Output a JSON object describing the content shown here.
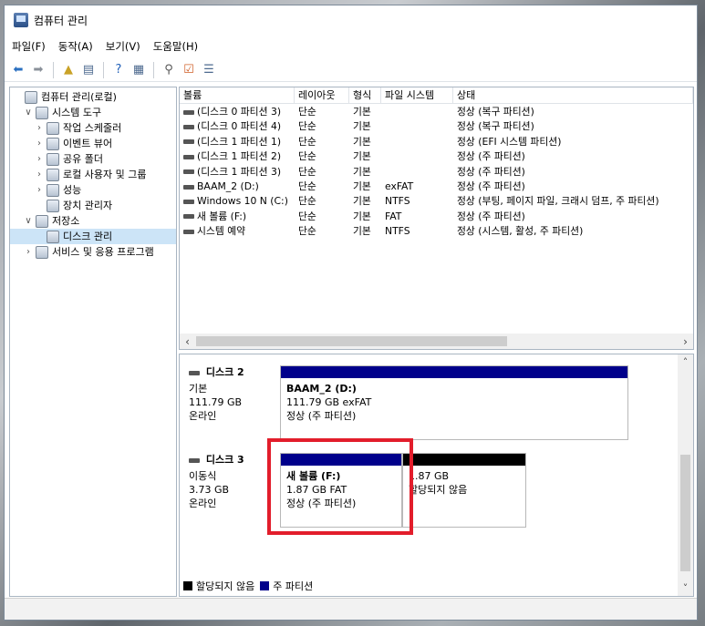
{
  "window": {
    "title": "컴퓨터 관리"
  },
  "menu": [
    "파일(F)",
    "동작(A)",
    "보기(V)",
    "도움말(H)"
  ],
  "tree": [
    {
      "label": "컴퓨터 관리(로컬)",
      "level": 0,
      "expander": ""
    },
    {
      "label": "시스템 도구",
      "level": 1,
      "expander": "∨"
    },
    {
      "label": "작업 스케줄러",
      "level": 2,
      "expander": "›"
    },
    {
      "label": "이벤트 뷰어",
      "level": 2,
      "expander": "›"
    },
    {
      "label": "공유 폴더",
      "level": 2,
      "expander": "›"
    },
    {
      "label": "로컬 사용자 및 그룹",
      "level": 2,
      "expander": "›"
    },
    {
      "label": "성능",
      "level": 2,
      "expander": "›"
    },
    {
      "label": "장치 관리자",
      "level": 2,
      "expander": ""
    },
    {
      "label": "저장소",
      "level": 1,
      "expander": "∨"
    },
    {
      "label": "디스크 관리",
      "level": 2,
      "expander": "",
      "selected": true
    },
    {
      "label": "서비스 및 응용 프로그램",
      "level": 1,
      "expander": "›"
    }
  ],
  "volume_list": {
    "headers": [
      "볼륨",
      "레이아웃",
      "형식",
      "파일 시스템",
      "상태"
    ],
    "rows": [
      [
        "(디스크 0 파티션 3)",
        "단순",
        "기본",
        "",
        "정상 (복구 파티션)"
      ],
      [
        "(디스크 0 파티션 4)",
        "단순",
        "기본",
        "",
        "정상 (복구 파티션)"
      ],
      [
        "(디스크 1 파티션 1)",
        "단순",
        "기본",
        "",
        "정상 (EFI 시스템 파티션)"
      ],
      [
        "(디스크 1 파티션 2)",
        "단순",
        "기본",
        "",
        "정상 (주 파티션)"
      ],
      [
        "(디스크 1 파티션 3)",
        "단순",
        "기본",
        "",
        "정상 (주 파티션)"
      ],
      [
        "BAAM_2 (D:)",
        "단순",
        "기본",
        "exFAT",
        "정상 (주 파티션)"
      ],
      [
        "Windows 10 N (C:)",
        "단순",
        "기본",
        "NTFS",
        "정상 (부팅, 페이지 파일, 크래시 덤프, 주 파티션)"
      ],
      [
        "새 볼륨 (F:)",
        "단순",
        "기본",
        "FAT",
        "정상 (주 파티션)"
      ],
      [
        "시스템 예약",
        "단순",
        "기본",
        "NTFS",
        "정상 (시스템, 활성, 주 파티션)"
      ]
    ]
  },
  "disks": [
    {
      "name": "디스크 2",
      "info": [
        "기본",
        "111.79 GB",
        "온라인"
      ],
      "partitions": [
        {
          "title": "BAAM_2  (D:)",
          "line1": "111.79 GB exFAT",
          "line2": "정상 (주 파티션)",
          "kind": "primary"
        }
      ]
    },
    {
      "name": "디스크 3",
      "info": [
        "이동식",
        "3.73 GB",
        "온라인"
      ],
      "partitions": [
        {
          "title": "새 볼륨  (F:)",
          "line1": "1.87 GB FAT",
          "line2": "정상 (주 파티션)",
          "kind": "primary"
        },
        {
          "title": "",
          "line1": "1.87 GB",
          "line2": "할당되지 않음",
          "kind": "unallocated"
        }
      ]
    }
  ],
  "legend": [
    {
      "label": "할당되지 않음",
      "color": "#000000"
    },
    {
      "label": "주 파티션",
      "color": "#00008b"
    }
  ],
  "colors": {
    "primary": "#00008b",
    "unallocated": "#000000",
    "highlight": "#e21d2b",
    "selection": "#cce4f7"
  }
}
